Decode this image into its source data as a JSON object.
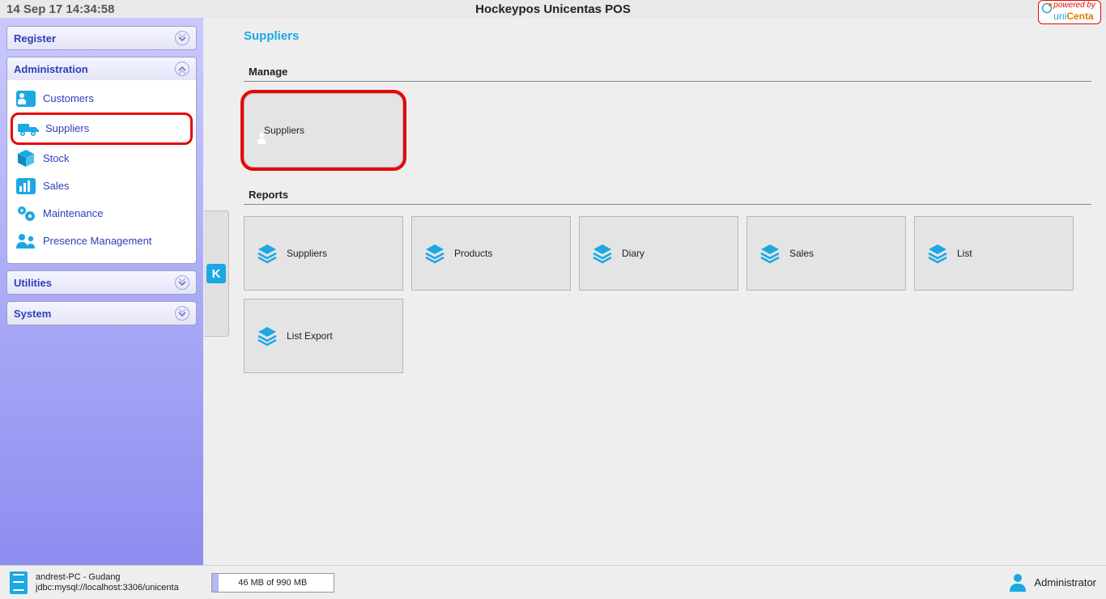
{
  "header": {
    "timestamp": "14 Sep 17 14:34:58",
    "title": "Hockeypos Unicentas POS",
    "powered_line1": "powered by",
    "powered_line2a": "uni",
    "powered_line2b": "Centa"
  },
  "sidebar": {
    "register": {
      "label": "Register"
    },
    "administration": {
      "label": "Administration",
      "items": [
        {
          "label": "Customers",
          "icon": "person"
        },
        {
          "label": "Suppliers",
          "icon": "truck"
        },
        {
          "label": "Stock",
          "icon": "cube"
        },
        {
          "label": "Sales",
          "icon": "bars"
        },
        {
          "label": "Maintenance",
          "icon": "gears"
        },
        {
          "label": "Presence Management",
          "icon": "people"
        }
      ]
    },
    "utilities": {
      "label": "Utilities"
    },
    "system": {
      "label": "System"
    }
  },
  "main": {
    "title": "Suppliers",
    "manage": {
      "label": "Manage",
      "cards": [
        {
          "label": "Suppliers",
          "icon": "person"
        }
      ]
    },
    "reports": {
      "label": "Reports",
      "cards": [
        {
          "label": "Suppliers"
        },
        {
          "label": "Products"
        },
        {
          "label": "Diary"
        },
        {
          "label": "Sales"
        },
        {
          "label": "List"
        },
        {
          "label": "List Export"
        }
      ]
    }
  },
  "status": {
    "host": "andrest-PC - Gudang",
    "jdbc": "jdbc:mysql://localhost:3306/unicenta",
    "memory": "46 MB of 990 MB",
    "user": "Administrator"
  }
}
